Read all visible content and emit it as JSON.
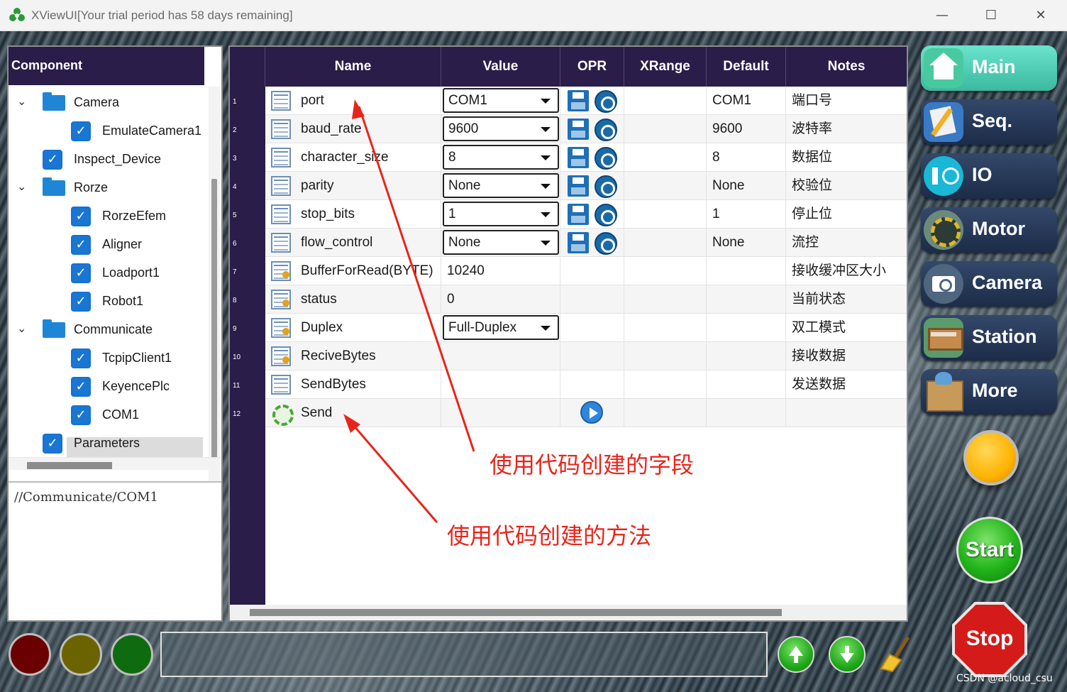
{
  "window": {
    "title": "XViewUI[Your trial period has 58 days remaining]",
    "minimize": "—",
    "maximize": "☐",
    "close": "✕"
  },
  "component_panel": {
    "header": "Component",
    "tree": [
      {
        "label": "Camera",
        "type": "folder",
        "expanded": true
      },
      {
        "label": "EmulateCamera1",
        "type": "checked"
      },
      {
        "label": "Inspect_Device",
        "type": "checked"
      },
      {
        "label": "Rorze",
        "type": "folder",
        "expanded": true
      },
      {
        "label": "RorzeEfem",
        "type": "checked"
      },
      {
        "label": "Aligner",
        "type": "checked"
      },
      {
        "label": "Loadport1",
        "type": "checked"
      },
      {
        "label": "Robot1",
        "type": "checked"
      },
      {
        "label": "Communicate",
        "type": "folder",
        "expanded": true
      },
      {
        "label": "TcpipClient1",
        "type": "checked"
      },
      {
        "label": "KeyencePlc",
        "type": "checked"
      },
      {
        "label": "COM1",
        "type": "checked",
        "selected": true
      },
      {
        "label": "Parameters",
        "type": "checked"
      }
    ],
    "path": "//Communicate/COM1"
  },
  "grid": {
    "columns": [
      "Name",
      "Value",
      "OPR",
      "XRange",
      "Default",
      "Notes"
    ],
    "rows": [
      {
        "num": "1",
        "name": "port",
        "value": "COM1",
        "editor": "combo",
        "opr": "save-apply",
        "default": "COM1",
        "notes": "端口号",
        "icon": "field"
      },
      {
        "num": "2",
        "name": "baud_rate",
        "value": "9600",
        "editor": "combo",
        "opr": "save-apply",
        "default": "9600",
        "notes": "波特率",
        "icon": "field"
      },
      {
        "num": "3",
        "name": "character_size",
        "value": "8",
        "editor": "combo",
        "opr": "save-apply",
        "default": "8",
        "notes": "数据位",
        "icon": "field"
      },
      {
        "num": "4",
        "name": "parity",
        "value": "None",
        "editor": "combo",
        "opr": "save-apply",
        "default": "None",
        "notes": "校验位",
        "icon": "field"
      },
      {
        "num": "5",
        "name": "stop_bits",
        "value": "1",
        "editor": "combo",
        "opr": "save-apply",
        "default": "1",
        "notes": "停止位",
        "icon": "field"
      },
      {
        "num": "6",
        "name": "flow_control",
        "value": "None",
        "editor": "combo",
        "opr": "save-apply",
        "default": "None",
        "notes": "流控",
        "icon": "field"
      },
      {
        "num": "7",
        "name": "BufferForRead(BYTE)",
        "value": "10240",
        "editor": "text",
        "opr": "",
        "default": "",
        "notes": "接收缓冲区大小",
        "icon": "field-key"
      },
      {
        "num": "8",
        "name": "status",
        "value": "0",
        "editor": "text",
        "opr": "",
        "default": "",
        "notes": "当前状态",
        "icon": "field-key"
      },
      {
        "num": "9",
        "name": "Duplex",
        "value": "Full-Duplex",
        "editor": "combo",
        "opr": "",
        "default": "",
        "notes": "双工模式",
        "icon": "field-key"
      },
      {
        "num": "10",
        "name": "ReciveBytes",
        "value": "",
        "editor": "text",
        "opr": "",
        "default": "",
        "notes": "接收数据",
        "icon": "field-key"
      },
      {
        "num": "11",
        "name": "SendBytes",
        "value": "",
        "editor": "text",
        "opr": "",
        "default": "",
        "notes": "发送数据",
        "icon": "field"
      },
      {
        "num": "12",
        "name": "Send",
        "value": "",
        "editor": "text",
        "opr": "play",
        "default": "",
        "notes": "",
        "icon": "method"
      }
    ]
  },
  "annotations": {
    "fields_note": "使用代码创建的字段",
    "method_note": "使用代码创建的方法",
    "color": "#e8251b"
  },
  "nav": [
    {
      "label": "Main",
      "icon": "home-icon"
    },
    {
      "label": "Seq.",
      "icon": "sequence-icon"
    },
    {
      "label": "IO",
      "icon": "io-icon"
    },
    {
      "label": "Motor",
      "icon": "motor-icon"
    },
    {
      "label": "Camera",
      "icon": "camera-icon"
    },
    {
      "label": "Station",
      "icon": "station-icon"
    },
    {
      "label": "More",
      "icon": "more-icon"
    }
  ],
  "controls": {
    "start": "Start",
    "stop": "Stop"
  },
  "status_lamps": [
    {
      "name": "red",
      "color": "#6b0000"
    },
    {
      "name": "yellow",
      "color": "#6b6300"
    },
    {
      "name": "green",
      "color": "#0f6b0f"
    }
  ],
  "watermark": "CSDN @acloud_csu"
}
